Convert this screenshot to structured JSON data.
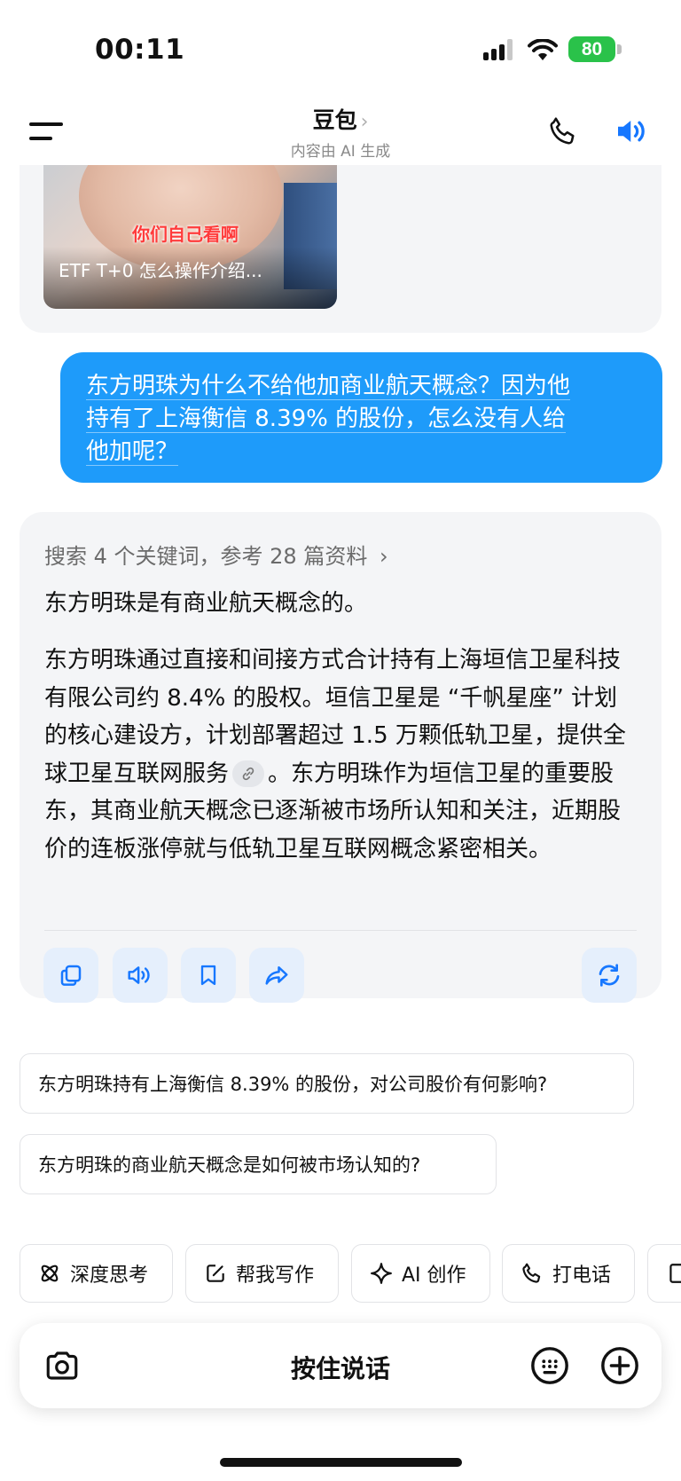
{
  "status_bar": {
    "time": "00:11",
    "battery": "80"
  },
  "header": {
    "title": "豆包",
    "title_chevron": "›",
    "subtitle": "内容由 AI 生成"
  },
  "prev_card": {
    "video_title": "ETF T+0 怎么操作介绍...",
    "video_overlay_text": "你们自己看啊"
  },
  "user_message": {
    "line1": "东方明珠为什么不给他加商业航天概念？因为他",
    "line2": "持有了上海衡信 8.39% 的股份，怎么没有人给",
    "line3": "他加呢？"
  },
  "answer": {
    "search_summary": "搜索 4 个关键词，参考 28 篇资料",
    "search_chevron": "›",
    "paragraph1": "东方明珠是有商业航天概念的。",
    "paragraph2_a": "东方明珠通过直接和间接方式合计持有上海垣信卫星科技有限公司约 8.4% 的股权。垣信卫星是 “千帆星座” 计划的核心建设方，计划部署超过 1.5 万颗低轨卫星，提供全球卫星互联网服务",
    "paragraph2_b": "。东方明珠作为垣信卫星的重要股东，其商业航天概念已逐渐被市场所认知和关注，近期股价的连板涨停就与低轨卫星互联网概念紧密相关。",
    "actions": [
      "copy-icon",
      "read-aloud-icon",
      "bookmark-icon",
      "share-icon",
      "regenerate-icon"
    ]
  },
  "suggestions": [
    "东方明珠持有上海衡信 8.39% 的股份，对公司股价有何影响?",
    "东方明珠的商业航天概念是如何被市场认知的?"
  ],
  "chips": [
    "深度思考",
    "帮我写作",
    "AI 创作",
    "打电话"
  ],
  "input_bar": {
    "hold_to_talk": "按住说话"
  },
  "colors": {
    "accent": "#1e9bfa",
    "card_bg": "#f4f5f7",
    "battery": "#2ac24a"
  }
}
